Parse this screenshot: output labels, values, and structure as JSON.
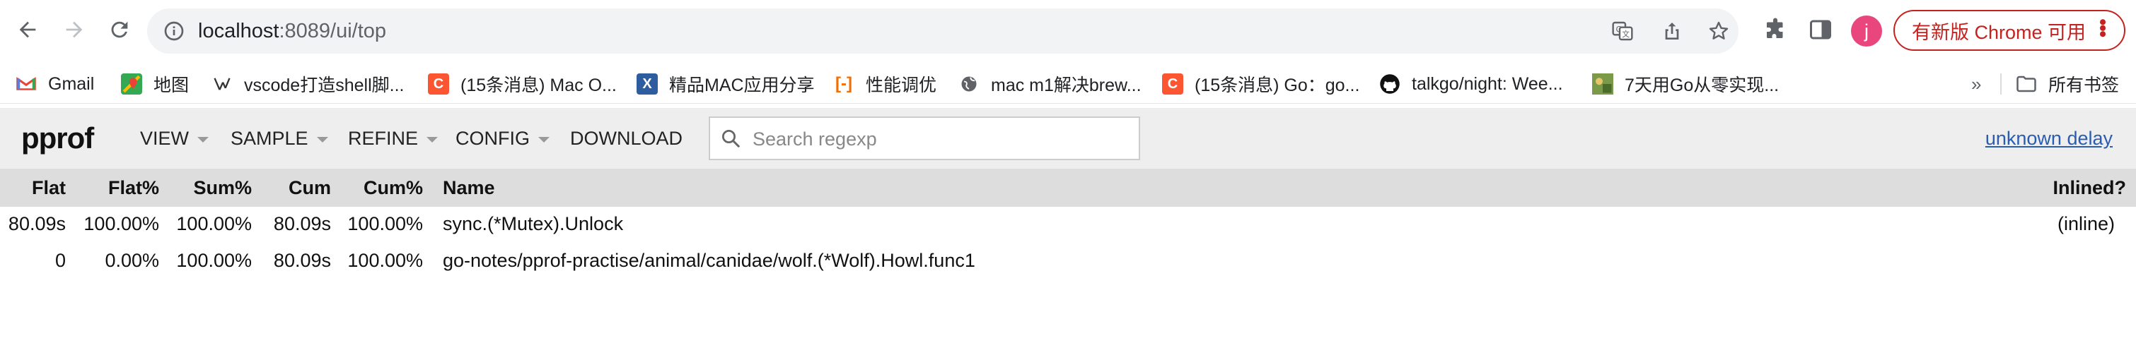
{
  "browser": {
    "url_host": "localhost",
    "url_rest": ":8089/ui/top",
    "update_label": "有新版 Chrome 可用",
    "avatar_letter": "j"
  },
  "bookmarks": {
    "items": [
      {
        "label": "Gmail",
        "icon": "gmail-icon"
      },
      {
        "label": "地图",
        "icon": "maps-icon"
      },
      {
        "label": "vscode打造shell脚...",
        "icon": "vscode-bookmark-icon"
      },
      {
        "label": "(15条消息) Mac O...",
        "icon": "csdn-icon"
      },
      {
        "label": "精品MAC应用分享",
        "icon": "mac-app-icon"
      },
      {
        "label": "性能调优",
        "icon": "perf-icon"
      },
      {
        "label": "mac m1解决brew...",
        "icon": "globe-icon"
      },
      {
        "label": "(15条消息) Go：go...",
        "icon": "csdn-icon"
      },
      {
        "label": "talkgo/night: Wee...",
        "icon": "github-icon"
      },
      {
        "label": "7天用Go从零实现...",
        "icon": "image-thumb-icon"
      }
    ],
    "more": "»",
    "all_bookmarks": "所有书签"
  },
  "pprof": {
    "logo": "pprof",
    "menus": [
      "VIEW",
      "SAMPLE",
      "REFINE",
      "CONFIG"
    ],
    "download": "DOWNLOAD",
    "search_placeholder": "Search regexp",
    "delay_link": "unknown delay"
  },
  "table": {
    "headers": {
      "flat": "Flat",
      "flat_pct": "Flat%",
      "sum_pct": "Sum%",
      "cum": "Cum",
      "cum_pct": "Cum%",
      "name": "Name",
      "inlined": "Inlined?"
    },
    "rows": [
      {
        "flat": "80.09s",
        "flat_pct": "100.00%",
        "sum_pct": "100.00%",
        "cum": "80.09s",
        "cum_pct": "100.00%",
        "name": "sync.(*Mutex).Unlock",
        "inlined": "(inline)"
      },
      {
        "flat": "0",
        "flat_pct": "0.00%",
        "sum_pct": "100.00%",
        "cum": "80.09s",
        "cum_pct": "100.00%",
        "name": "go-notes/pprof-practise/animal/canidae/wolf.(*Wolf).Howl.func1",
        "inlined": ""
      }
    ]
  }
}
